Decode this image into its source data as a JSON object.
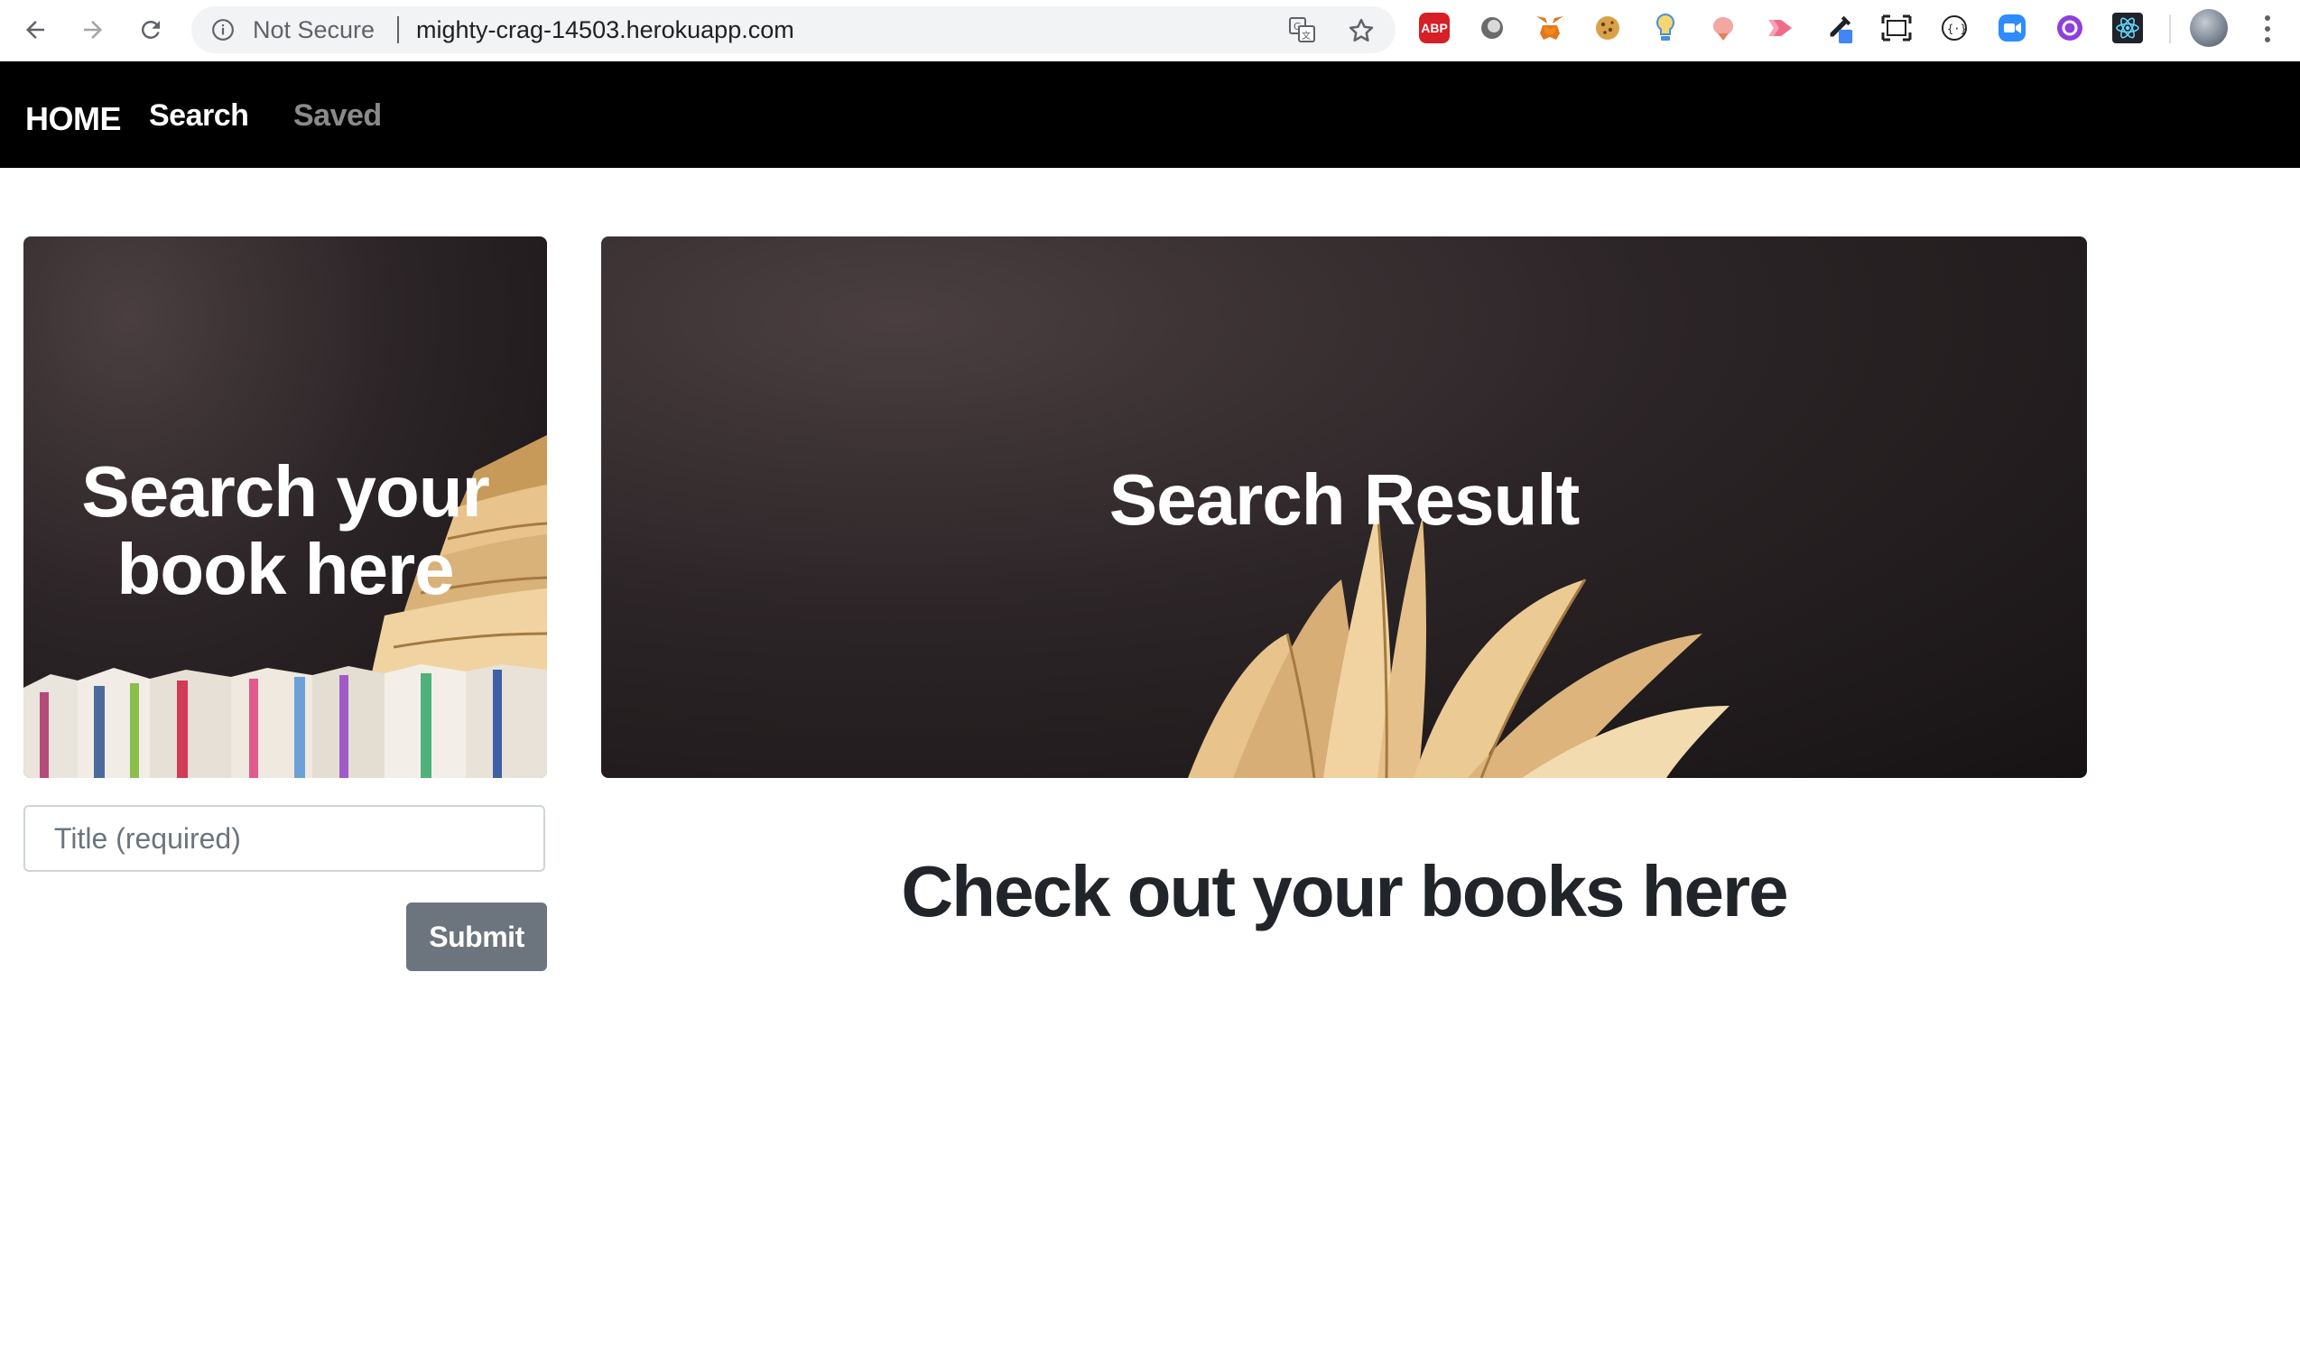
{
  "browser": {
    "security_label": "Not Secure",
    "url": "mighty-crag-14503.herokuapp.com",
    "extension_abp_label": "ABP"
  },
  "nav": {
    "brand": "HOME",
    "links": [
      {
        "label": "Search",
        "active": true
      },
      {
        "label": "Saved",
        "active": false
      }
    ]
  },
  "search_hero": {
    "title_line1": "Search your",
    "title_line2": "book here"
  },
  "results_hero": {
    "title": "Search Result"
  },
  "form": {
    "title_placeholder": "Title (required)",
    "submit_label": "Submit"
  },
  "main": {
    "heading": "Check out your books here"
  },
  "colors": {
    "navbar_bg": "#000000",
    "nav_active": "#ffffff",
    "nav_inactive": "#8a8a8a",
    "button_bg": "#6c757d",
    "hero_bg": "#221c1d",
    "page_bg": "#ffffff"
  }
}
